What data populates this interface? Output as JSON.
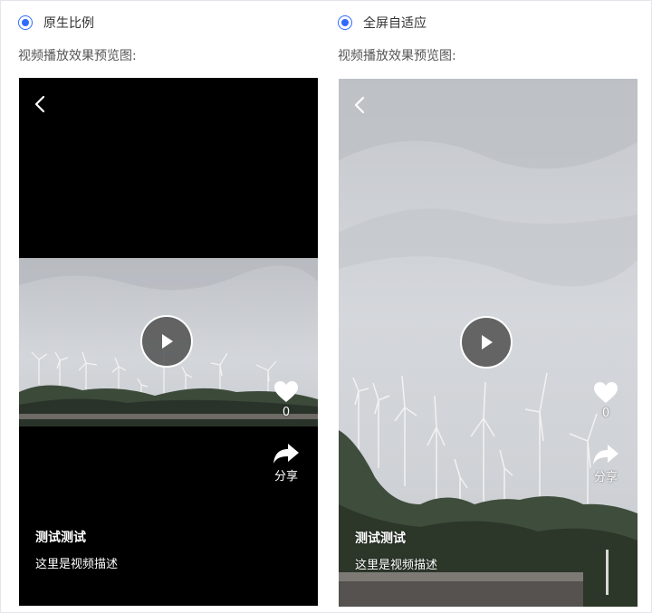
{
  "options": [
    {
      "label": "原生比例",
      "selected": true,
      "preview_label": "视频播放效果预览图:",
      "like_count": "0",
      "share_label": "分享",
      "video_title": "测试测试",
      "video_desc": "这里是视频描述"
    },
    {
      "label": "全屏自适应",
      "selected": true,
      "preview_label": "视频播放效果预览图:",
      "like_count": "0",
      "share_label": "分享",
      "video_title": "测试测试",
      "video_desc": "这里是视频描述"
    }
  ],
  "icons": {
    "radio": "radio-selected-icon",
    "back": "chevron-left-icon",
    "play": "play-icon",
    "like": "heart-icon",
    "share": "share-arrow-icon"
  },
  "colors": {
    "accent": "#2f6bff",
    "phone_background": "#000000",
    "overlay_text": "#ffffff"
  }
}
